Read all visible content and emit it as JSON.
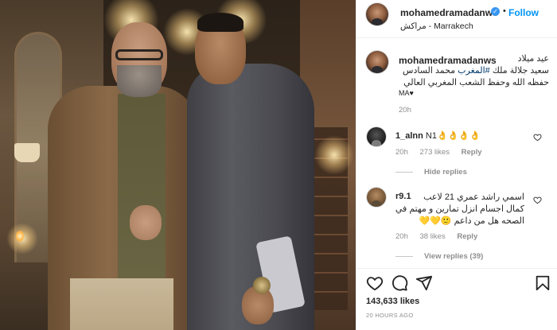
{
  "post": {
    "author": "mohamedramadanws",
    "verified_mark": "✓",
    "dot": "•",
    "follow_label": "Follow",
    "location": "مراكش - Marrakech"
  },
  "caption": {
    "author": "mohamedramadanws",
    "line1": "عيد ميلاد",
    "line2_before_tag": "سعيد جلالة ملك ",
    "line2_tag": "#المغرب",
    "line2_after_tag": " محمد السادس",
    "line3": "حفظه الله وحفظ الشعب المغربي العالي",
    "line4": "MA♥",
    "time": "20h"
  },
  "comments": [
    {
      "user": "1_alnn",
      "text": "N1",
      "emoji": "👌👌👌👌",
      "time": "20h",
      "likes": "273 likes",
      "reply_label": "Reply",
      "toggle_label": "Hide replies"
    },
    {
      "user": "r9.1",
      "text_line1": "اسمي راشد عمري 21 لاعب",
      "text_line2": "كمال اجسام انزل تمارين و مهتم في",
      "text_line3": "الصحه هل من داعم 🙂💛💛",
      "time": "20h",
      "likes": "38 likes",
      "reply_label": "Reply",
      "toggle_label": "View replies (39)"
    }
  ],
  "footer": {
    "likes_count": "143,633 likes",
    "post_time": "20 HOURS AGO"
  },
  "icons": {
    "like": "heart-icon",
    "comment": "comment-icon",
    "share": "share-icon",
    "save": "bookmark-icon"
  },
  "colors": {
    "link_blue": "#0095f6",
    "verified_blue": "#3897f0",
    "muted_text": "#8e8e8e",
    "hashtag": "#00376b"
  }
}
